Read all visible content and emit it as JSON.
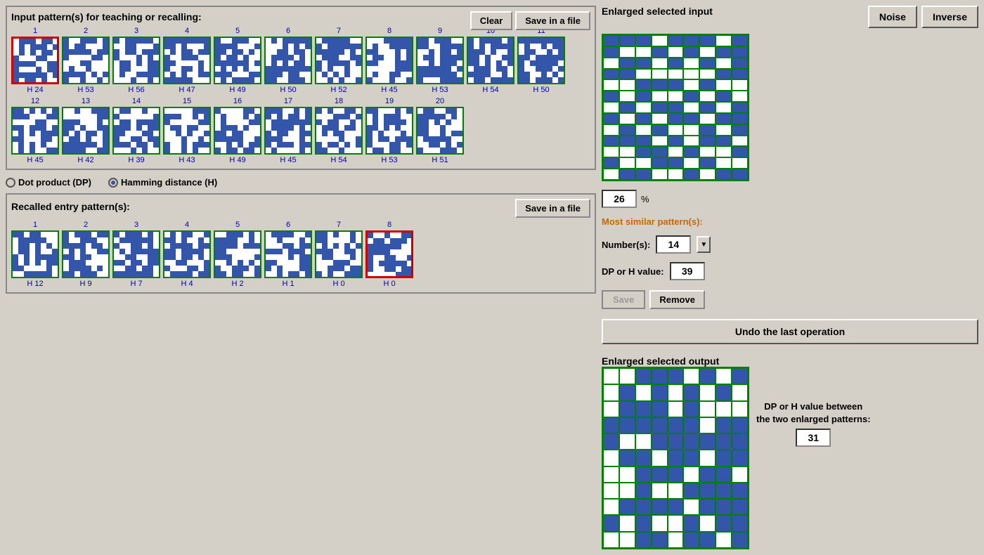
{
  "header": {
    "input_title": "Input pattern(s) for teaching or recalling:",
    "clear_label": "Clear",
    "save_file_label": "Save in a file",
    "output_save_label": "Save in a file",
    "recalled_title": "Recalled entry pattern(s):"
  },
  "radio": {
    "dot_product": "Dot product (DP)",
    "hamming": "Hamming distance (H)",
    "hamming_selected": true
  },
  "right_panel": {
    "enlarged_input_title": "Enlarged selected input",
    "noise_label": "Noise",
    "inverse_label": "Inverse",
    "percent_value": "26",
    "percent_symbol": "%",
    "most_similar_label": "Most similar pattern(s):",
    "numbers_label": "Number(s):",
    "numbers_value": "14",
    "dp_h_label": "DP or H value:",
    "dp_h_value": "39",
    "save_label": "Save",
    "remove_label": "Remove",
    "undo_label": "Undo the last operation",
    "enlarged_output_title": "Enlarged selected output",
    "dp_between_label": "DP or H value between\nthe two enlarged patterns:",
    "dp_between_value": "31"
  },
  "input_patterns": [
    {
      "num": "1",
      "label": "H 24",
      "selected": true
    },
    {
      "num": "2",
      "label": "H 53",
      "selected": false
    },
    {
      "num": "3",
      "label": "H 56",
      "selected": false
    },
    {
      "num": "4",
      "label": "H 47",
      "selected": false
    },
    {
      "num": "5",
      "label": "H 49",
      "selected": false
    },
    {
      "num": "6",
      "label": "H 50",
      "selected": false
    },
    {
      "num": "7",
      "label": "H 52",
      "selected": false
    },
    {
      "num": "8",
      "label": "H 45",
      "selected": false
    },
    {
      "num": "9",
      "label": "H 53",
      "selected": false
    },
    {
      "num": "10",
      "label": "H 54",
      "selected": false
    },
    {
      "num": "11",
      "label": "H 50",
      "selected": false
    },
    {
      "num": "12",
      "label": "H 45",
      "selected": false
    },
    {
      "num": "13",
      "label": "H 42",
      "selected": false
    },
    {
      "num": "14",
      "label": "H 39",
      "selected": false
    },
    {
      "num": "15",
      "label": "H 43",
      "selected": false
    },
    {
      "num": "16",
      "label": "H 49",
      "selected": false
    },
    {
      "num": "17",
      "label": "H 45",
      "selected": false
    },
    {
      "num": "18",
      "label": "H 54",
      "selected": false
    },
    {
      "num": "19",
      "label": "H 53",
      "selected": false
    },
    {
      "num": "20",
      "label": "H 51",
      "selected": false
    }
  ],
  "output_patterns": [
    {
      "num": "1",
      "label": "H 12",
      "selected": false
    },
    {
      "num": "2",
      "label": "H 9",
      "selected": false
    },
    {
      "num": "3",
      "label": "H 7",
      "selected": false
    },
    {
      "num": "4",
      "label": "H 4",
      "selected": false
    },
    {
      "num": "5",
      "label": "H 2",
      "selected": false
    },
    {
      "num": "6",
      "label": "H 1",
      "selected": false
    },
    {
      "num": "7",
      "label": "H 0",
      "selected": false
    },
    {
      "num": "8",
      "label": "H 0",
      "selected": true
    }
  ]
}
